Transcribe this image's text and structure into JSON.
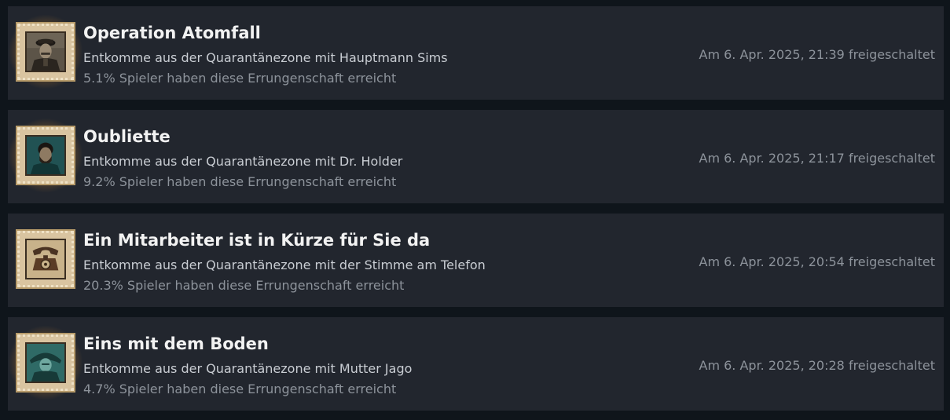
{
  "achievements": [
    {
      "title": "Operation Atomfall",
      "description": "Entkomme aus der Quarantänezone mit Hauptmann Sims",
      "percent": "5.1% Spieler haben diese Errungenschaft erreicht",
      "unlocked": "Am 6. Apr. 2025, 21:39 freigeschaltet",
      "icon": "soldier-portrait-icon"
    },
    {
      "title": "Oubliette",
      "description": "Entkomme aus der Quarantänezone mit Dr. Holder",
      "percent": "9.2% Spieler haben diese Errungenschaft erreicht",
      "unlocked": "Am 6. Apr. 2025, 21:17 freigeschaltet",
      "icon": "doctor-portrait-icon"
    },
    {
      "title": "Ein Mitarbeiter ist in Kürze für Sie da",
      "description": "Entkomme aus der Quarantänezone mit der Stimme am Telefon",
      "percent": "20.3% Spieler haben diese Errungenschaft erreicht",
      "unlocked": "Am 6. Apr. 2025, 20:54 freigeschaltet",
      "icon": "telephone-icon"
    },
    {
      "title": "Eins mit dem Boden",
      "description": "Entkomme aus der Quarantänezone mit Mutter Jago",
      "percent": "4.7% Spieler haben diese Errungenschaft erreicht",
      "unlocked": "Am 6. Apr. 2025, 20:28 freigeschaltet",
      "icon": "hooded-woman-portrait-icon"
    }
  ],
  "colors": {
    "background": "#0f151b",
    "row": "#22262e",
    "title": "#f2f2f2",
    "description": "#c9cdd3",
    "muted": "#8d939b",
    "glow": "#ffba46"
  }
}
